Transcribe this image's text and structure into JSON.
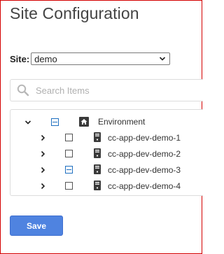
{
  "page": {
    "title": "Site Configuration"
  },
  "site": {
    "label": "Site:",
    "selected": "demo"
  },
  "search": {
    "placeholder": "Search Items"
  },
  "tree": {
    "root": {
      "label": "Environment",
      "expanded": true,
      "check_state": "partial",
      "icon": "home-icon"
    },
    "children": [
      {
        "label": "cc-app-dev-demo-1",
        "expanded": false,
        "check_state": "unchecked",
        "icon": "server-icon"
      },
      {
        "label": "cc-app-dev-demo-2",
        "expanded": false,
        "check_state": "unchecked",
        "icon": "server-icon"
      },
      {
        "label": "cc-app-dev-demo-3",
        "expanded": false,
        "check_state": "partial",
        "icon": "server-icon"
      },
      {
        "label": "cc-app-dev-demo-4",
        "expanded": false,
        "check_state": "unchecked",
        "icon": "server-icon"
      }
    ]
  },
  "actions": {
    "save_label": "Save"
  },
  "colors": {
    "accent": "#4f83e0",
    "partial_check": "#1e6fc0",
    "frame_border": "#d40000"
  }
}
